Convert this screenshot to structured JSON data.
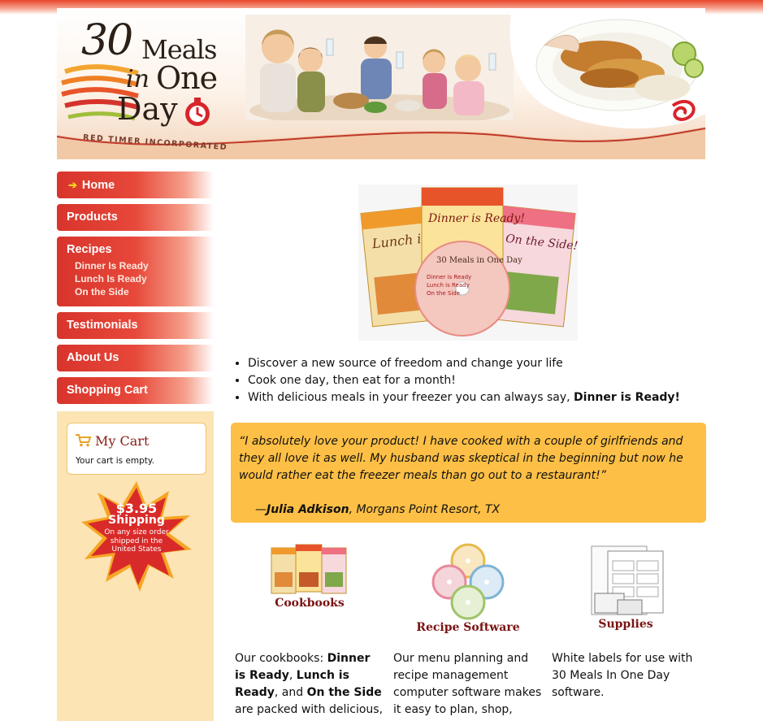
{
  "header": {
    "logo_number": "30",
    "logo_meals": "Meals",
    "logo_in": "in",
    "logo_one": "One",
    "logo_day": "Day",
    "logo_tagline": "RED TIMER INCORPORATED"
  },
  "nav": {
    "items": [
      {
        "label": "Home"
      },
      {
        "label": "Products"
      },
      {
        "label": "Recipes",
        "sub": [
          "Dinner Is Ready",
          "Lunch Is Ready",
          "On the Side"
        ]
      },
      {
        "label": "Testimonials"
      },
      {
        "label": "About Us"
      },
      {
        "label": "Shopping Cart"
      }
    ]
  },
  "cart": {
    "title": "My Cart",
    "status": "Your cart is empty."
  },
  "shipping_burst": {
    "price": "$3.95",
    "label": "Shipping",
    "note": "On any size order shipped in the United States"
  },
  "hero": {
    "book1": "Lunch is Ready!",
    "book2": "Dinner is Ready!",
    "book3": "On the Side!",
    "disc_title": "30 Meals in One Day",
    "disc_lines": [
      "Dinner is Ready",
      "Lunch is Ready",
      "On the Side"
    ]
  },
  "bullets": [
    "Discover a new source of freedom and change your life",
    "Cook one day, then eat for a month!",
    "With delicious meals in your freezer you can always say, "
  ],
  "bullet_bold": "Dinner is Ready!",
  "testimonial": {
    "quote": "“I absolutely love your product! I have cooked with a couple of girlfriends and they all love it as well. My husband was skeptical in the beginning but now he would rather eat the freezer meals than go out to a restaurant!”",
    "dash": "—",
    "name": "Julia Adkison",
    "location": ", Morgans Point Resort, TX"
  },
  "features": {
    "cookbooks": "Cookbooks",
    "software": "Recipe Software",
    "supplies": "Supplies"
  },
  "descriptions": {
    "cookbooks_pre": "Our cookbooks: ",
    "cookbooks_b1": "Dinner is Ready",
    "cookbooks_c1": ", ",
    "cookbooks_b2": "Lunch is Ready",
    "cookbooks_c2": ", and ",
    "cookbooks_b3": "On the Side",
    "cookbooks_post": " are packed with delicious,",
    "software": "Our menu planning and recipe management computer software makes it easy to plan, shop,",
    "supplies": "White labels for use with 30 Meals In One Day software."
  },
  "colors": {
    "nav_red": "#d8342c",
    "sidebar_bg": "#fce4b5",
    "quote_bg": "#fdbf45",
    "feature_title": "#7a1212"
  }
}
